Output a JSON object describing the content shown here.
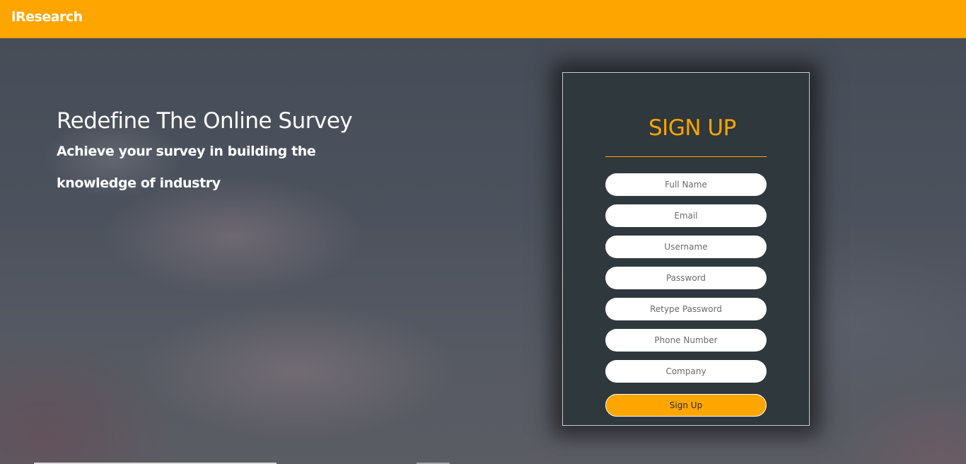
{
  "header": {
    "brand": "iResearch"
  },
  "hero": {
    "title": "Redefine The Online Survey",
    "subtitle_line1": "Achieve your survey in building the",
    "subtitle_line2": "knowledge of industry"
  },
  "signup": {
    "title": "SIGN UP",
    "fields": {
      "full_name": "Full Name",
      "email": "Email",
      "username": "Username",
      "password": "Password",
      "retype_password": "Retype Password",
      "phone_number": "Phone Number",
      "company": "Company"
    },
    "submit_label": "Sign Up"
  },
  "colors": {
    "accent": "#ffa500",
    "card_background": "#2e383d",
    "text_light": "#ffffff"
  }
}
